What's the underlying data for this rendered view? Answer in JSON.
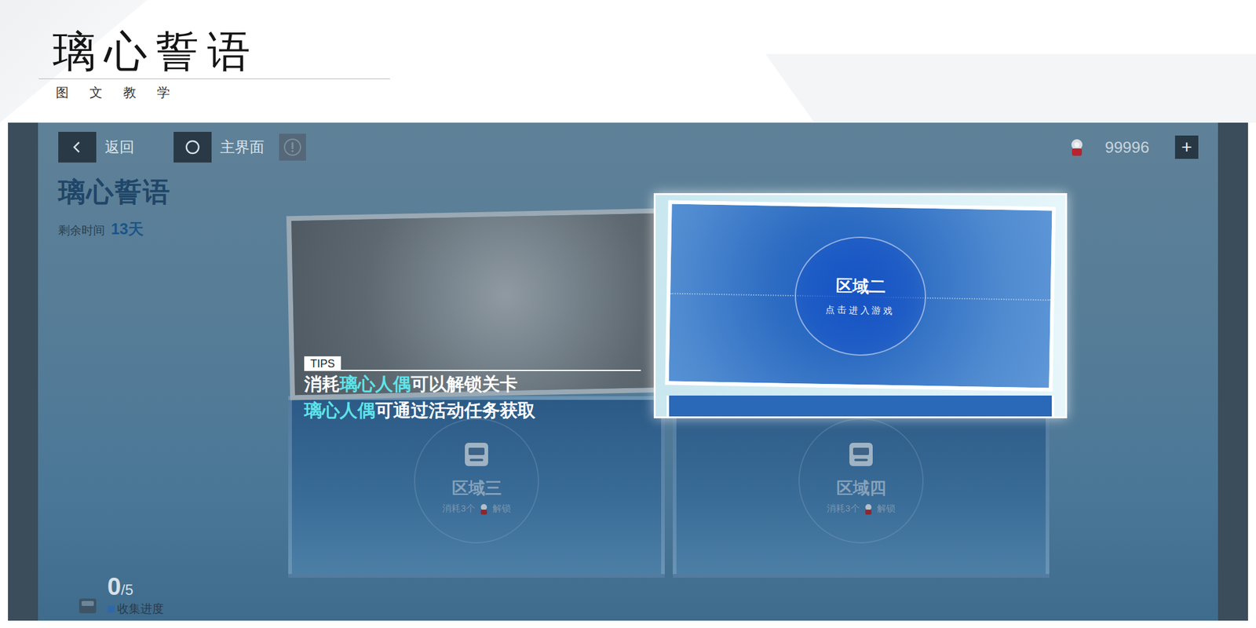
{
  "header": {
    "title": "璃心誓语",
    "subtitle": "图 文 教 学"
  },
  "screen": {
    "nav": [
      {
        "label": "返回",
        "kind": "back"
      },
      {
        "label": "主界面",
        "kind": "home"
      }
    ],
    "currency": {
      "amount": "99996",
      "add": "+"
    },
    "event": {
      "title": "璃心誓语",
      "remaining_label": "剩余时间",
      "remaining": "13天"
    },
    "areas": [
      {
        "kind": "photo",
        "highlighted": false,
        "locked": false
      },
      {
        "kind": "entry",
        "name": "区域二",
        "hint": "点击进入游戏",
        "highlighted": true,
        "locked": false
      },
      {
        "kind": "locked",
        "name": "区域三",
        "cost": "消耗3个",
        "action": "解锁",
        "highlighted": false,
        "locked": true
      },
      {
        "kind": "locked",
        "name": "区域四",
        "cost": "消耗3个",
        "action": "解锁",
        "highlighted": false,
        "locked": true
      }
    ],
    "tips": {
      "label": "TIPS",
      "lines": [
        [
          {
            "text": "消耗",
            "highlight": false
          },
          {
            "text": "璃心人偶",
            "highlight": true
          },
          {
            "text": "可以解锁关卡",
            "highlight": false
          }
        ],
        [
          {
            "text": "璃心人偶",
            "highlight": true
          },
          {
            "text": "可通过活动任务获取",
            "highlight": false
          }
        ]
      ]
    },
    "progress": {
      "count": "0",
      "total": "/5",
      "label": "收集进度"
    }
  }
}
